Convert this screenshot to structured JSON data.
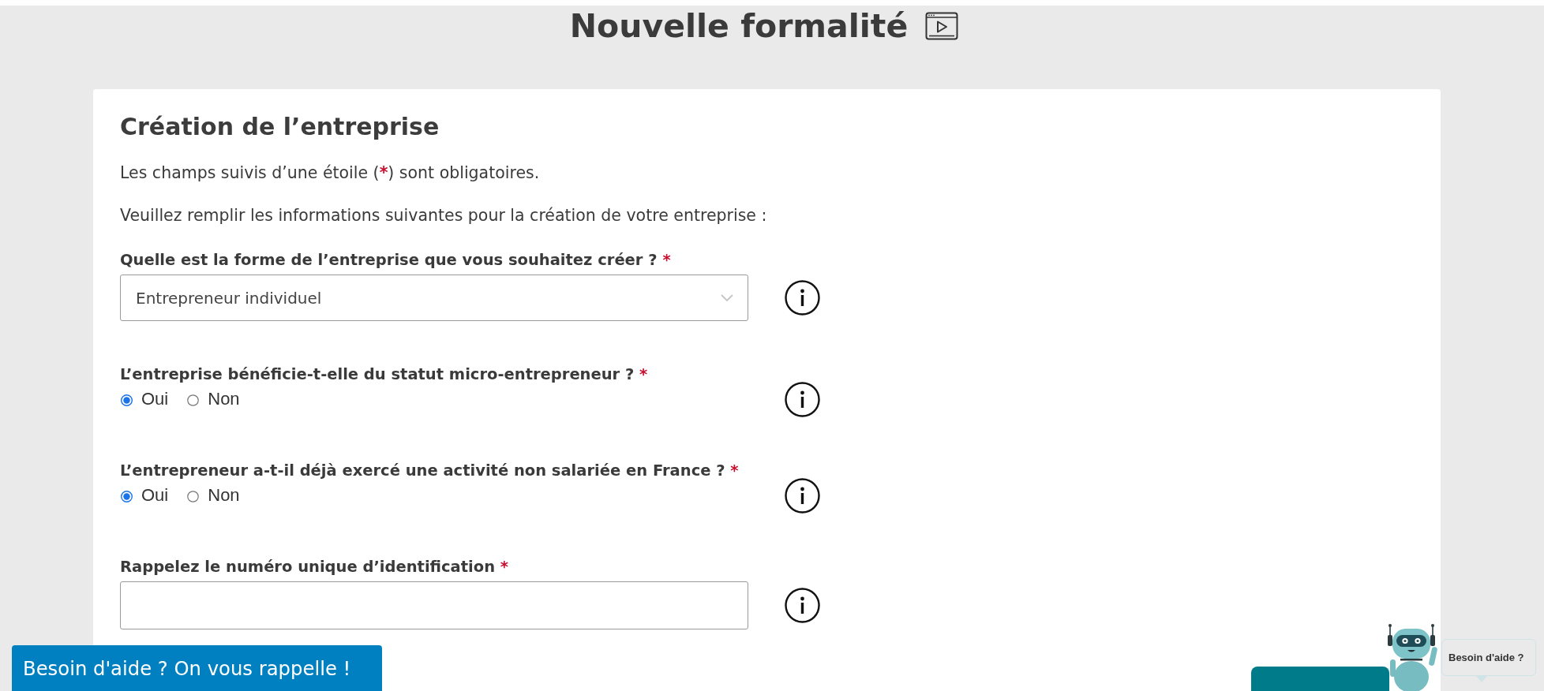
{
  "page_title": "Nouvelle formalité",
  "card": {
    "title": "Création de l’entreprise",
    "required_note": {
      "before": "Les champs suivis d’une étoile (",
      "mark": "*",
      "after": ") sont obligatoires."
    },
    "intro": "Veuillez remplir les informations suivantes pour la création de votre entreprise :",
    "fields": [
      {
        "kind": "select",
        "label": "Quelle est la forme de l’entreprise que vous souhaitez créer ?",
        "required_mark": "*",
        "value": "Entrepreneur individuel",
        "info": true
      },
      {
        "kind": "radio",
        "label": "L’entreprise bénéficie-t-elle du statut micro-entrepreneur ?",
        "required_mark": "*",
        "options": [
          {
            "label": "Oui",
            "selected": true
          },
          {
            "label": "Non",
            "selected": false
          }
        ],
        "info": true
      },
      {
        "kind": "radio",
        "label": "L’entrepreneur a-t-il déjà exercé une activité non salariée en France ?",
        "required_mark": "*",
        "options": [
          {
            "label": "Oui",
            "selected": true
          },
          {
            "label": "Non",
            "selected": false
          }
        ],
        "info": true
      },
      {
        "kind": "text",
        "label": "Rappelez le numéro unique d’identification",
        "required_mark": "*",
        "info": true
      }
    ]
  },
  "callback_button": {
    "label": "Besoin d'aide ? On vous rappelle !"
  },
  "chat_widget": {
    "bubble": "Besoin d'aide ?"
  }
}
